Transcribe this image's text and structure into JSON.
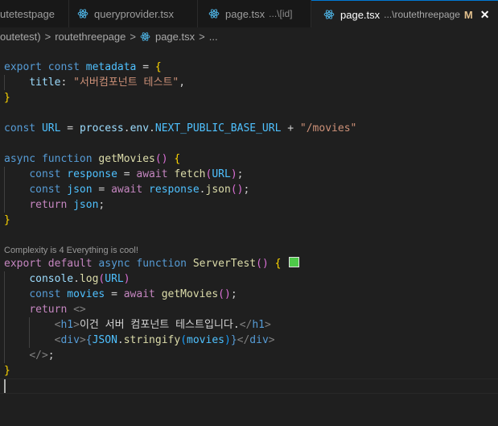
{
  "tabs": [
    {
      "label": "utetestpage",
      "description": "",
      "modified": "",
      "active": false
    },
    {
      "label": "queryprovider.tsx",
      "description": "",
      "modified": "",
      "active": false
    },
    {
      "label": "page.tsx",
      "description": "...\\[id]",
      "modified": "",
      "active": false
    },
    {
      "label": "page.tsx",
      "description": "...\\routethreepage",
      "modified": "M",
      "active": true
    }
  ],
  "close_glyph": "✕",
  "breadcrumb": {
    "items": [
      "outetest)",
      "routethreepage",
      "page.tsx",
      "..."
    ],
    "separator": ">"
  },
  "codelens": "Complexity is 4 Everything is cool!",
  "code": {
    "l1": {
      "export": "export",
      "const": "const",
      "name": "metadata",
      "eq": " = ",
      "brace": "{"
    },
    "l2": {
      "key": "title",
      "colon": ": ",
      "value": "\"서버컴포넌트 테스트\"",
      "comma": ","
    },
    "l3": {
      "brace": "}"
    },
    "l4": {
      "const": "const",
      "name": "URL",
      "eq": " = ",
      "obj": "process",
      "dot1": ".",
      "prop1": "env",
      "dot2": ".",
      "prop2": "NEXT_PUBLIC_BASE_URL",
      "plus": " + ",
      "str": "\"/movies\""
    },
    "l5": {
      "async": "async",
      "function": "function",
      "name": "getMovies",
      "paren": "()",
      "brace": "{"
    },
    "l6": {
      "const": "const",
      "name": "response",
      "eq": " = ",
      "await": "await",
      "fn": "fetch",
      "open": "(",
      "arg": "URL",
      "close": ")",
      "semi": ";"
    },
    "l7": {
      "const": "const",
      "name": "json",
      "eq": " = ",
      "await": "await",
      "obj": "response",
      "dot": ".",
      "fn": "json",
      "paren": "()",
      "semi": ";"
    },
    "l8": {
      "return": "return",
      "name": "json",
      "semi": ";"
    },
    "l9": {
      "brace": "}"
    },
    "l10": {
      "export": "export",
      "default": "default",
      "async": "async",
      "function": "function",
      "name": "ServerTest",
      "paren": "()",
      "brace": "{"
    },
    "l11": {
      "obj": "console",
      "dot": ".",
      "fn": "log",
      "open": "(",
      "arg": "URL",
      "close": ")"
    },
    "l12": {
      "const": "const",
      "name": "movies",
      "eq": " = ",
      "await": "await",
      "fn": "getMovies",
      "paren": "()",
      "semi": ";"
    },
    "l13": {
      "return": "return",
      "frag": "<>"
    },
    "l14": {
      "open_lt": "<",
      "tag": "h1",
      "open_gt": ">",
      "text": "이건 서버 컴포넌트 테스트입니다.",
      "close_lt": "</",
      "close_tag": "h1",
      "close_gt": ">"
    },
    "l15": {
      "open_lt": "<",
      "tag": "div",
      "open_gt": ">",
      "brace_open": "{",
      "obj": "JSON",
      "dot": ".",
      "fn": "stringify",
      "paren_open": "(",
      "arg": "movies",
      "paren_close": ")",
      "brace_close": "}",
      "close_lt": "</",
      "close_tag": "div",
      "close_gt": ">"
    },
    "l16": {
      "frag_close": "</>",
      "semi": ";"
    },
    "l17": {
      "brace": "}"
    }
  },
  "colors": {
    "keyword": "#569cd6",
    "control": "#c586c0",
    "variable": "#9cdcfe",
    "constant": "#4fc1ff",
    "function": "#dcdcaa",
    "string": "#ce9178",
    "bracket_1": "#ffd700",
    "bracket_2": "#da70d6",
    "bracket_3": "#179fff",
    "modified": "#e2c08d",
    "active_tab_border": "#0078d4",
    "color_swatch": "#4ec949"
  },
  "icons": {
    "tab": "react-icon",
    "breadcrumb": "react-icon"
  }
}
